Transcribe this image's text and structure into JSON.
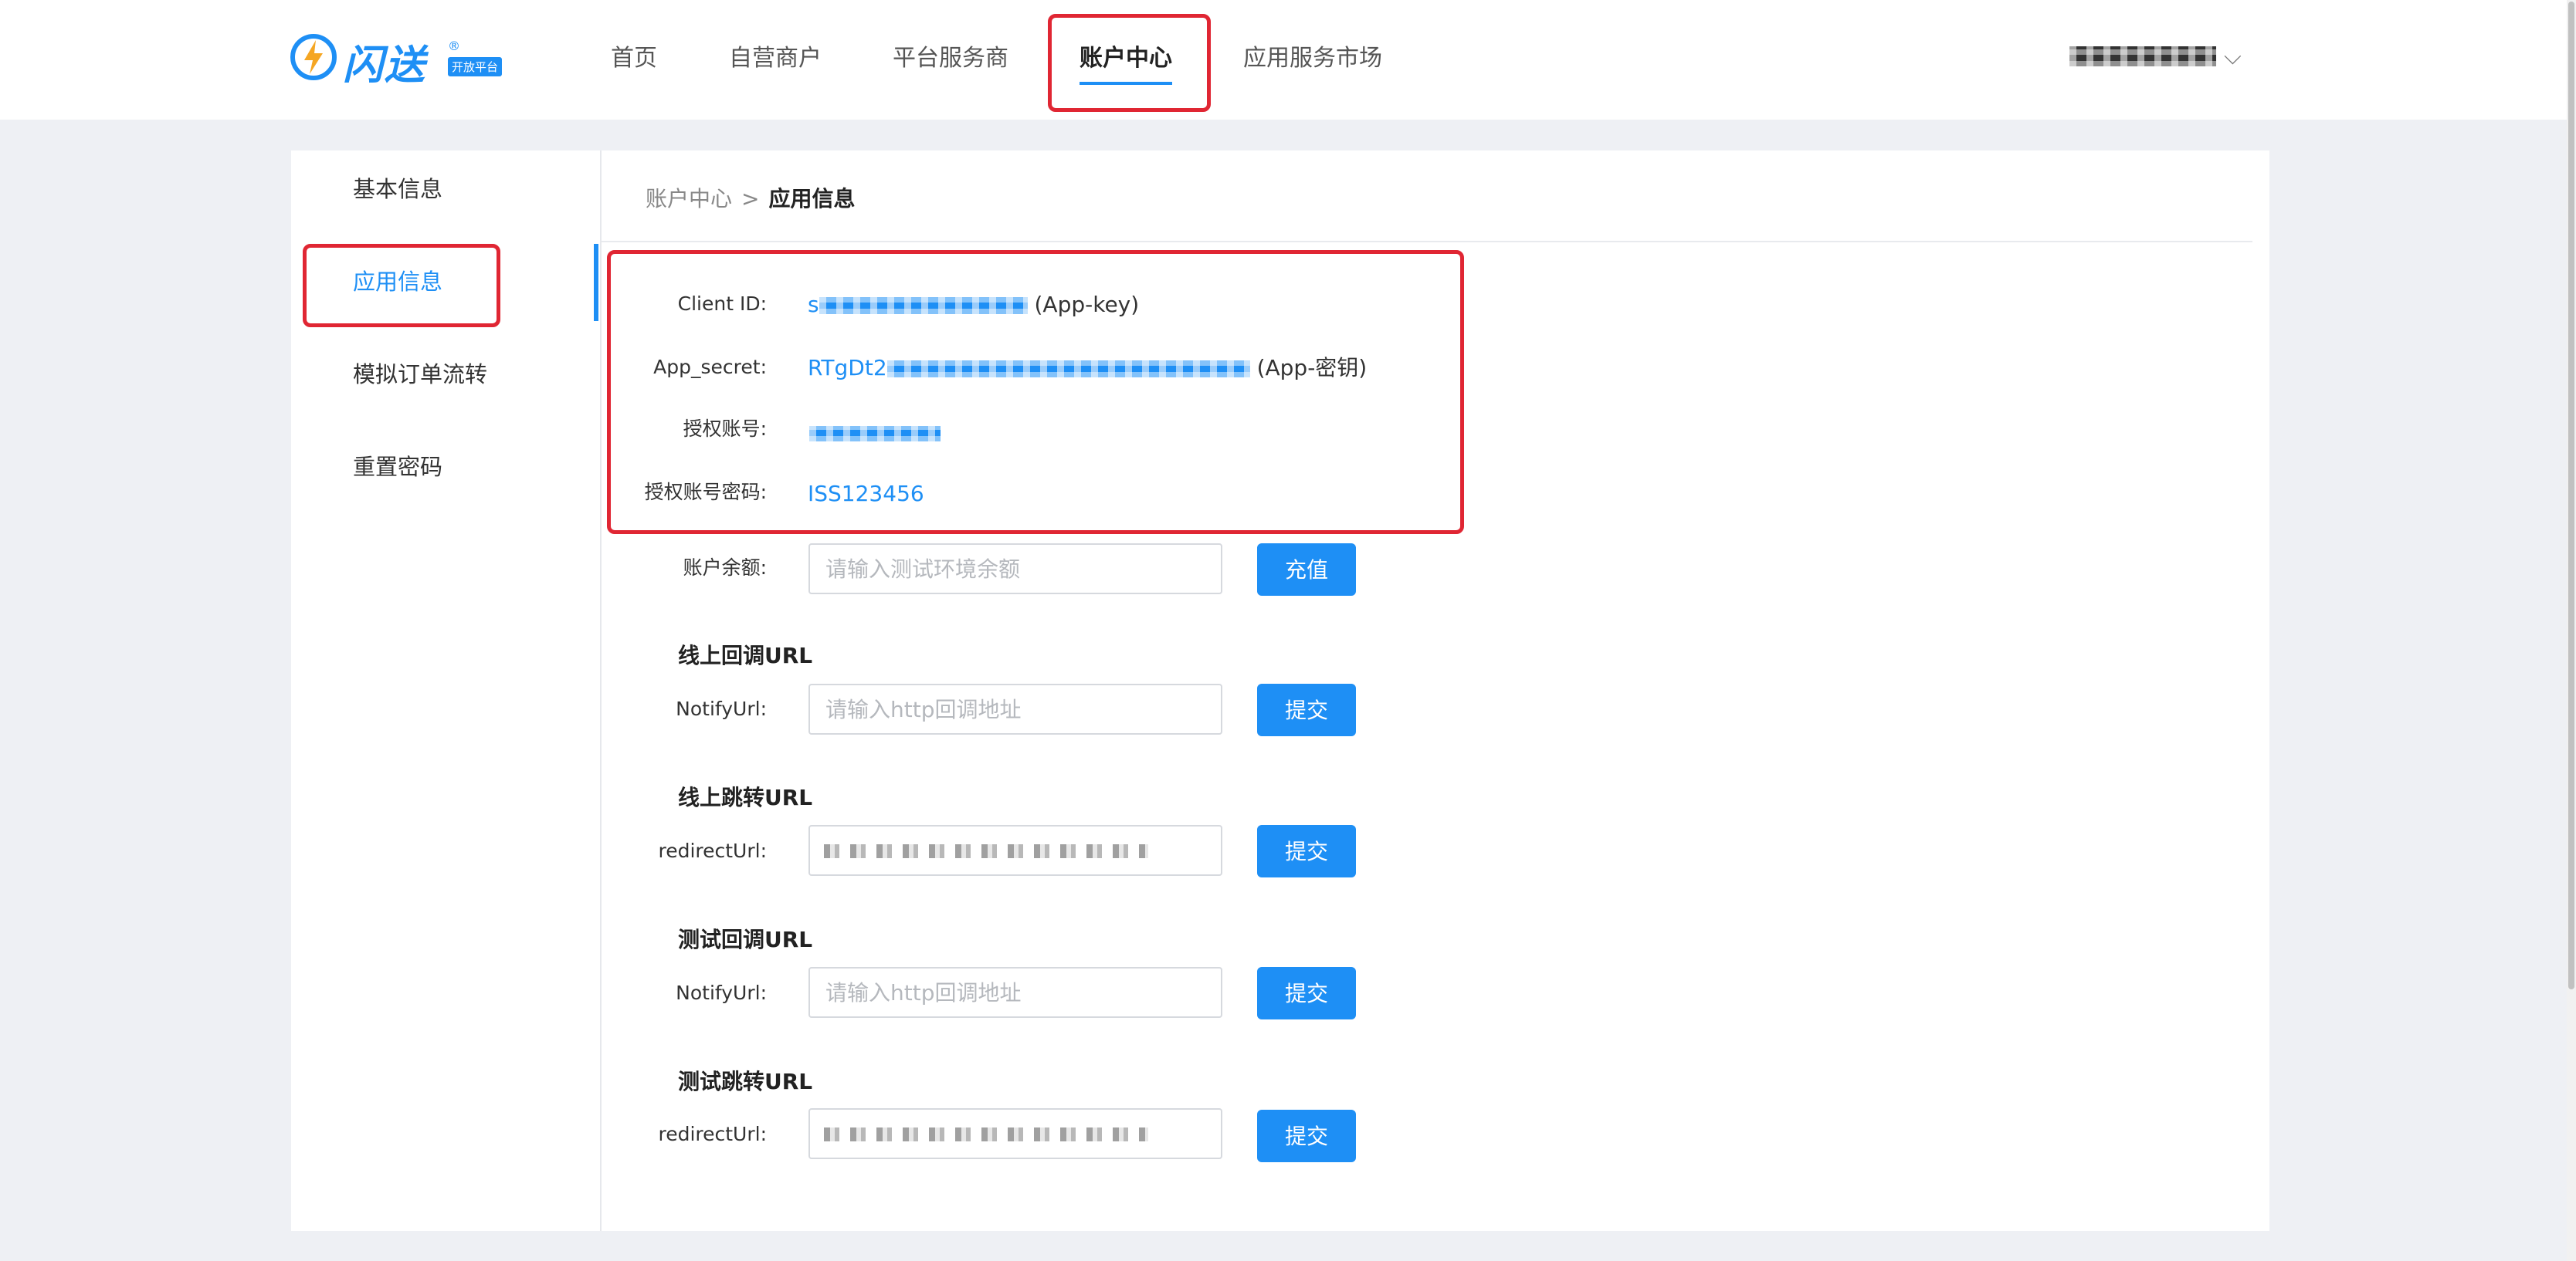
{
  "brand": {
    "name": "闪送",
    "badge": "开放平台",
    "registered": "®"
  },
  "colors": {
    "accent": "#1e8ff5",
    "highlight": "#e02633"
  },
  "nav": {
    "items": [
      {
        "label": "首页"
      },
      {
        "label": "自营商户"
      },
      {
        "label": "平台服务商"
      },
      {
        "label": "账户中心",
        "active": true
      },
      {
        "label": "应用服务市场"
      }
    ]
  },
  "sidebar": {
    "items": [
      {
        "label": "基本信息"
      },
      {
        "label": "应用信息",
        "active": true
      },
      {
        "label": "模拟订单流转"
      },
      {
        "label": "重置密码"
      }
    ]
  },
  "breadcrumb": {
    "parent": "账户中心",
    "separator": ">",
    "current": "应用信息"
  },
  "app_info": {
    "client_id": {
      "label": "Client ID:",
      "value_visible": "s",
      "suffix": "(App-key)"
    },
    "app_secret": {
      "label": "App_secret:",
      "value_visible": "RTgDt2",
      "suffix": "(App-密钥)"
    },
    "auth_account": {
      "label": "授权账号:"
    },
    "auth_password": {
      "label": "授权账号密码:",
      "value": "ISS123456"
    }
  },
  "balance": {
    "label": "账户余额:",
    "placeholder": "请输入测试环境余额",
    "button": "充值"
  },
  "sections": [
    {
      "title": "线上回调URL",
      "label": "NotifyUrl:",
      "placeholder": "请输入http回调地址",
      "button": "提交"
    },
    {
      "title": "线上跳转URL",
      "label": "redirectUrl:",
      "placeholder": "",
      "button": "提交"
    },
    {
      "title": "测试回调URL",
      "label": "NotifyUrl:",
      "placeholder": "请输入http回调地址",
      "button": "提交"
    },
    {
      "title": "测试跳转URL",
      "label": "redirectUrl:",
      "placeholder": "",
      "button": "提交"
    }
  ]
}
